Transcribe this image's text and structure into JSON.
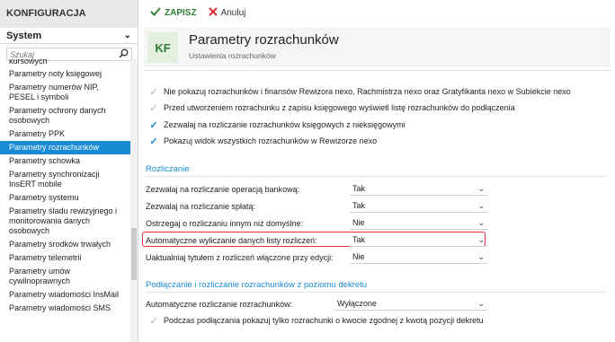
{
  "sidebar": {
    "title": "KONFIGURACJA",
    "module_select": "System",
    "search_placeholder": "Szukaj",
    "items": [
      {
        "label": "kursowych"
      },
      {
        "label": "Parametry noty księgowej"
      },
      {
        "label": "Parametry numerów NIP, PESEL i symboli"
      },
      {
        "label": "Parametry ochrony danych osobowych"
      },
      {
        "label": "Parametry PPK"
      },
      {
        "label": "Parametry rozrachunków"
      },
      {
        "label": "Parametry schowka"
      },
      {
        "label": "Parametry synchronizacji InsERT mobile"
      },
      {
        "label": "Parametry systemu"
      },
      {
        "label": "Parametry śladu rewizyjnego i monitorowania danych osobowych"
      },
      {
        "label": "Parametry środków trwałych"
      },
      {
        "label": "Parametry telemetrii"
      },
      {
        "label": "Parametry umów cywilnoprawnych"
      },
      {
        "label": "Parametry wiadomości InsMail"
      },
      {
        "label": "Parametry wiadomości SMS"
      }
    ],
    "active_index": 5
  },
  "toolbar": {
    "save_label": "ZAPISZ",
    "cancel_label": "Anuluj"
  },
  "header": {
    "badge": "KF",
    "title": "Parametry rozrachunków",
    "subtitle": "Ustawienia rozrachunków"
  },
  "checkboxes": [
    {
      "label": "Nie pokazuj rozrachunków i finansów Rewizora nexo, Rachmistrza nexo oraz Gratyfikanta nexo w Subiekcie nexo",
      "checked": true,
      "enabled": false
    },
    {
      "label": "Przed utworzeniem rozrachunku z zapisu księgowego wyświetl listę rozrachunków do podłączenia",
      "checked": true,
      "enabled": false
    },
    {
      "label": "Zezwalaj na rozliczanie rozrachunków księgowych z nieksięgowymi",
      "checked": true,
      "enabled": true
    },
    {
      "label": "Pokazuj widok wszystkich rozrachunków w Rewizorze nexo",
      "checked": true,
      "enabled": true
    }
  ],
  "section_rozliczanie": {
    "title": "Rozliczanie",
    "rows": [
      {
        "label": "Zezwalaj na rozliczanie operacją bankową:",
        "value": "Tak"
      },
      {
        "label": "Zezwalaj na rozliczanie spłatą:",
        "value": "Tak"
      },
      {
        "label": "Ostrzegaj o rozliczaniu innym niż domyślne:",
        "value": "Nie"
      },
      {
        "label": "Automatyczne wyliczanie danych listy rozliczeń:",
        "value": "Tak"
      },
      {
        "label": "Uaktualniaj tytułem z rozliczeń włączone przy edycji:",
        "value": "Nie"
      }
    ]
  },
  "section_podlaczanie": {
    "title": "Podłączanie i rozliczanie rozrachunków z poziomu dekretu",
    "row_label": "Automatyczne rozliczanie rozrachunków:",
    "row_value": "Wyłączone",
    "checkbox_label": "Podczas podłączania pokazuj tylko rozrachunki o kwocie zgodnej z kwotą pozycji dekretu"
  },
  "colors": {
    "accent": "#1a8ad4",
    "save": "#2e7d32",
    "cancel": "#e0303a",
    "highlight": "#e0303a"
  }
}
